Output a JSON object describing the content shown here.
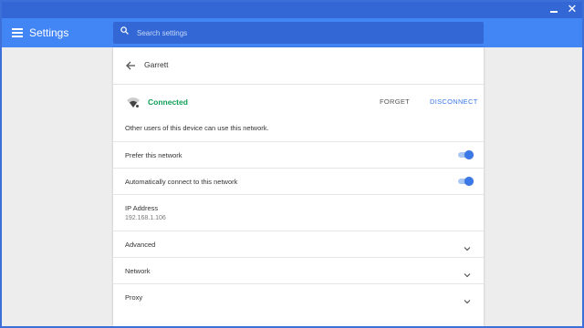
{
  "app": {
    "title": "Settings",
    "search_placeholder": "Search settings"
  },
  "network": {
    "name": "Garrett",
    "status": "Connected",
    "forget_label": "FORGET",
    "disconnect_label": "DISCONNECT",
    "shared_note": "Other users of this device can use this network."
  },
  "toggles": [
    {
      "label": "Prefer this network",
      "on": true
    },
    {
      "label": "Automatically connect to this network",
      "on": true
    }
  ],
  "ip": {
    "label": "IP Address",
    "value": "192.168.1.106"
  },
  "sections": [
    {
      "label": "Advanced"
    },
    {
      "label": "Network"
    },
    {
      "label": "Proxy"
    }
  ],
  "colors": {
    "accent": "#4285f4",
    "connected": "#0f9d58",
    "toggle_on": "#3b78e7"
  },
  "icons": {
    "menu": "hamburger-menu-icon",
    "search": "search-icon",
    "back": "arrow-back-icon",
    "wifi": "wifi-signal-icon",
    "expand": "chevron-down-icon"
  }
}
